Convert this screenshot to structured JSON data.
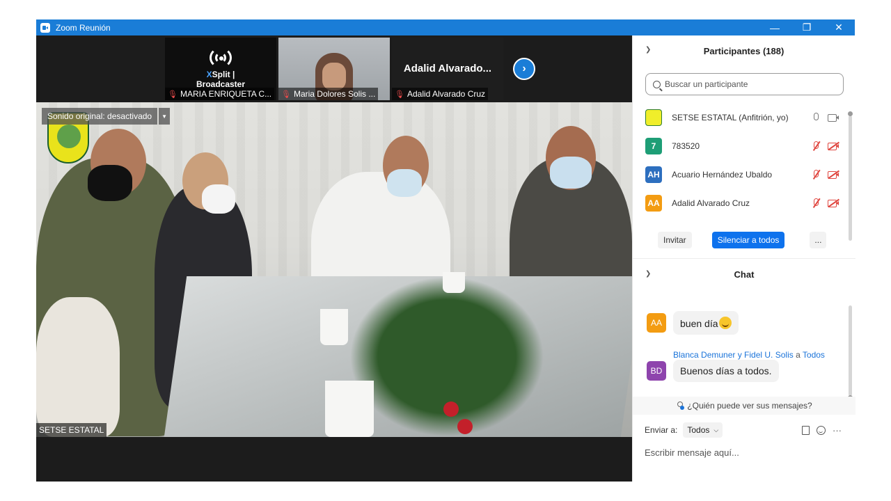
{
  "window": {
    "title": "Zoom Reunión",
    "minimize": "—",
    "restore": "❐",
    "close": "✕"
  },
  "colors": {
    "titlebar": "#1a7dd7",
    "primary_button": "#0e72ed",
    "muted_red": "#e0463f"
  },
  "thumbnails": [
    {
      "name": "MARIA ENRIQUETA C...",
      "brand_x": "X",
      "brand_rest": "Split | Broadcaster",
      "type": "xsplit"
    },
    {
      "name": "Maria Dolores Solis ...",
      "type": "video"
    },
    {
      "name": "Adalid Alvarado Cruz",
      "big_text": "Adalid  Alvarado...",
      "type": "text"
    }
  ],
  "next_button_icon": "chevron-right-icon",
  "main_video": {
    "original_sound": "Sonido original: desactivado",
    "speaker_name": "SETSE ESTATAL"
  },
  "participants": {
    "header": "Participantes (188)",
    "search_placeholder": "Buscar un participante",
    "list": [
      {
        "avatar": "",
        "avatar_color": "#f0ee2a",
        "name": "SETSE ESTATAL (Anfitrión, yo)",
        "mic": "on",
        "cam": "on"
      },
      {
        "avatar": "7",
        "avatar_color": "#1e9e76",
        "name": "783520",
        "mic": "off",
        "cam": "off"
      },
      {
        "avatar": "AH",
        "avatar_color": "#2d6fbf",
        "name": "Acuario Hernández Ubaldo",
        "mic": "off",
        "cam": "off"
      },
      {
        "avatar": "AA",
        "avatar_color": "#f39c12",
        "name": "Adalid Alvarado Cruz",
        "mic": "off",
        "cam": "off"
      }
    ],
    "invite": "Invitar",
    "mute_all": "Silenciar a todos",
    "more": "..."
  },
  "chat": {
    "header": "Chat",
    "messages": [
      {
        "avatar": "AA",
        "avatar_color": "#f39c12",
        "text": "buen día"
      },
      {
        "avatar": "BD",
        "avatar_color": "#8e44ad",
        "text": "Buenos días a todos."
      }
    ],
    "meta_from": "Blanca Demuner y Fidel U. Solis",
    "meta_a": "a",
    "meta_to": "Todos",
    "who_can_see": "¿Quién puede ver sus mensajes?",
    "send_to_label": "Enviar a:",
    "send_to_value": "Todos",
    "more_icon": "···",
    "input_placeholder": "Escribir mensaje aquí..."
  }
}
